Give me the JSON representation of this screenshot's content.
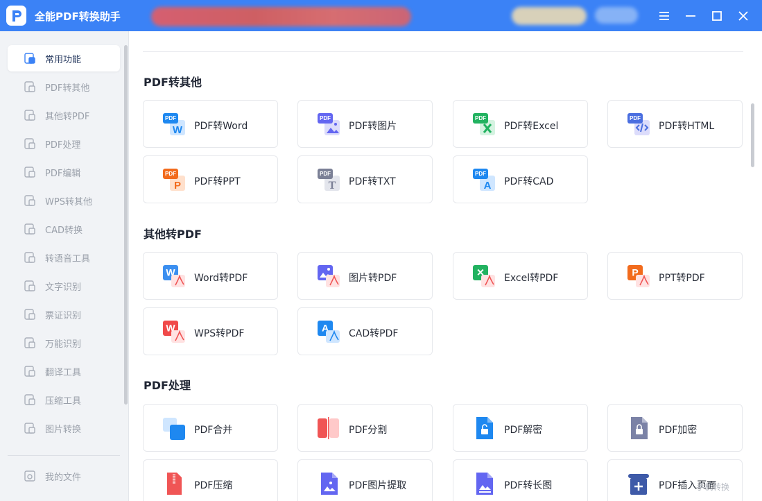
{
  "app": {
    "title": "全能PDF转换助手",
    "brand_color": "#3b82f6"
  },
  "sidebar": {
    "items": [
      {
        "label": "常用功能",
        "icon": "common-functions-icon",
        "active": true
      },
      {
        "label": "PDF转其他",
        "icon": "pdf-to-other-icon"
      },
      {
        "label": "其他转PDF",
        "icon": "other-to-pdf-icon"
      },
      {
        "label": "PDF处理",
        "icon": "pdf-process-icon"
      },
      {
        "label": "PDF编辑",
        "icon": "pdf-edit-icon"
      },
      {
        "label": "WPS转其他",
        "icon": "wps-to-other-icon"
      },
      {
        "label": "CAD转换",
        "icon": "cad-convert-icon"
      },
      {
        "label": "转语音工具",
        "icon": "text-to-speech-icon"
      },
      {
        "label": "文字识别",
        "icon": "ocr-icon"
      },
      {
        "label": "票证识别",
        "icon": "ticket-recognition-icon"
      },
      {
        "label": "万能识别",
        "icon": "universal-recognition-icon"
      },
      {
        "label": "翻译工具",
        "icon": "translate-icon"
      },
      {
        "label": "压缩工具",
        "icon": "compress-icon"
      },
      {
        "label": "图片转换",
        "icon": "image-convert-icon"
      }
    ],
    "footer": {
      "label": "我的文件",
      "icon": "my-files-icon"
    }
  },
  "sections": [
    {
      "title": "PDF转其他",
      "cards": [
        {
          "label": "PDF转Word",
          "icon": "pdf-to-word-icon"
        },
        {
          "label": "PDF转图片",
          "icon": "pdf-to-image-icon"
        },
        {
          "label": "PDF转Excel",
          "icon": "pdf-to-excel-icon"
        },
        {
          "label": "PDF转HTML",
          "icon": "pdf-to-html-icon"
        },
        {
          "label": "PDF转PPT",
          "icon": "pdf-to-ppt-icon"
        },
        {
          "label": "PDF转TXT",
          "icon": "pdf-to-txt-icon"
        },
        {
          "label": "PDF转CAD",
          "icon": "pdf-to-cad-icon"
        }
      ]
    },
    {
      "title": "其他转PDF",
      "cards": [
        {
          "label": "Word转PDF",
          "icon": "word-to-pdf-icon"
        },
        {
          "label": "图片转PDF",
          "icon": "image-to-pdf-icon"
        },
        {
          "label": "Excel转PDF",
          "icon": "excel-to-pdf-icon"
        },
        {
          "label": "PPT转PDF",
          "icon": "ppt-to-pdf-icon"
        },
        {
          "label": "WPS转PDF",
          "icon": "wps-to-pdf-icon"
        },
        {
          "label": "CAD转PDF",
          "icon": "cad-to-pdf-icon"
        }
      ]
    },
    {
      "title": "PDF处理",
      "cards": [
        {
          "label": "PDF合并",
          "icon": "pdf-merge-icon"
        },
        {
          "label": "PDF分割",
          "icon": "pdf-split-icon"
        },
        {
          "label": "PDF解密",
          "icon": "pdf-decrypt-icon"
        },
        {
          "label": "PDF加密",
          "icon": "pdf-encrypt-icon"
        },
        {
          "label": "PDF压缩",
          "icon": "pdf-compress-icon"
        },
        {
          "label": "PDF图片提取",
          "icon": "pdf-image-extract-icon"
        },
        {
          "label": "PDF转长图",
          "icon": "pdf-to-long-image-icon"
        },
        {
          "label": "PDF插入页面",
          "icon": "pdf-insert-page-icon"
        }
      ]
    }
  ],
  "watermark": "手机转换"
}
